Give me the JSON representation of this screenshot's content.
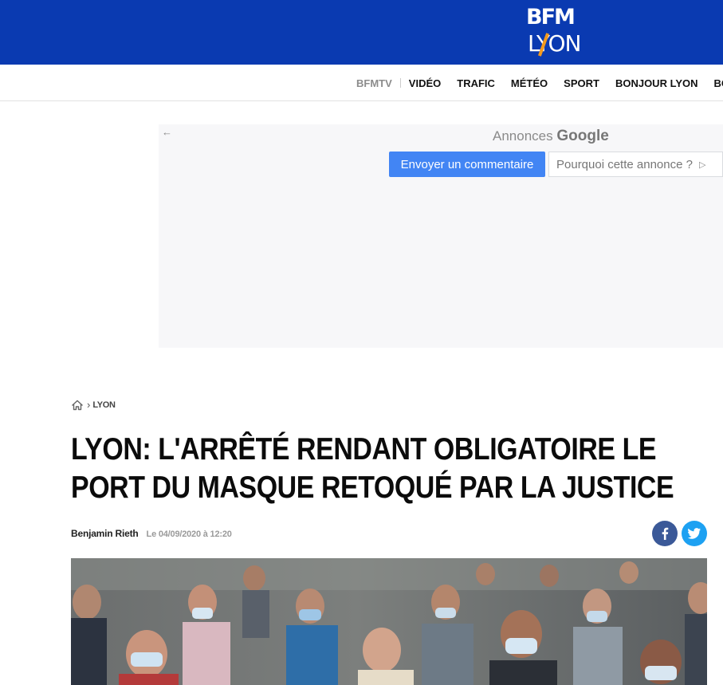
{
  "brand": {
    "logo_top": "BFM",
    "logo_city": "LYON",
    "primary_color": "#0a3ab1",
    "accent_color": "#f39a1e"
  },
  "nav": {
    "items": [
      "BFMTV",
      "VIDÉO",
      "TRAFIC",
      "MÉTÉO",
      "SPORT",
      "BONJOUR LYON",
      "BONSOIR LYON"
    ]
  },
  "ad": {
    "back_icon": "arrow-left-icon",
    "label_prefix": "Annonces",
    "label_brand": "Google",
    "feedback_button": "Envoyer un commentaire",
    "why_button": "Pourquoi cette annonce ?",
    "button_color": "#4285f4"
  },
  "breadcrumb": {
    "home_icon": "home-icon",
    "section": "LYON"
  },
  "article": {
    "title": "Lyon: l'arrêté rendant obligatoire le port du masque retoqué par la justice",
    "author": "Benjamin Rieth",
    "date": "Le 04/09/2020 à 12:20"
  },
  "share": {
    "facebook_icon": "facebook-icon",
    "twitter_icon": "twitter-icon",
    "facebook_color": "#3b5998",
    "twitter_color": "#1da1f2"
  }
}
